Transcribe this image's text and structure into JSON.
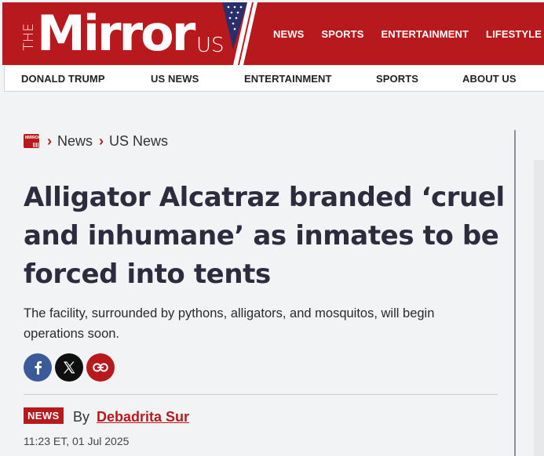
{
  "header": {
    "logo_the": "THE",
    "logo_brand": "Mirror",
    "logo_region": "US",
    "colors": {
      "brand_red": "#b8191d",
      "facebook": "#3b5a9a",
      "x": "#0f0f0f"
    },
    "nav": [
      "NEWS",
      "SPORTS",
      "ENTERTAINMENT",
      "LIFESTYLE"
    ]
  },
  "subnav": [
    "DONALD TRUMP",
    "US NEWS",
    "ENTERTAINMENT",
    "SPORTS",
    "ABOUT US"
  ],
  "breadcrumb": {
    "home_icon": "mirror-logo-icon",
    "items": [
      "News",
      "US News"
    ]
  },
  "article": {
    "headline": "Alligator Alcatraz branded ‘cruel and inhumane’ as inmates to be forced into tents",
    "standfirst": "The facility, surrounded by pythons, alligators, and mosquitos, will begin operations soon.",
    "share_icons": [
      "facebook-icon",
      "x-icon",
      "link-icon"
    ],
    "badge": "NEWS",
    "by_label": "By",
    "author": "Debadrita Sur",
    "timestamp": "11:23 ET, 01 Jul 2025"
  }
}
